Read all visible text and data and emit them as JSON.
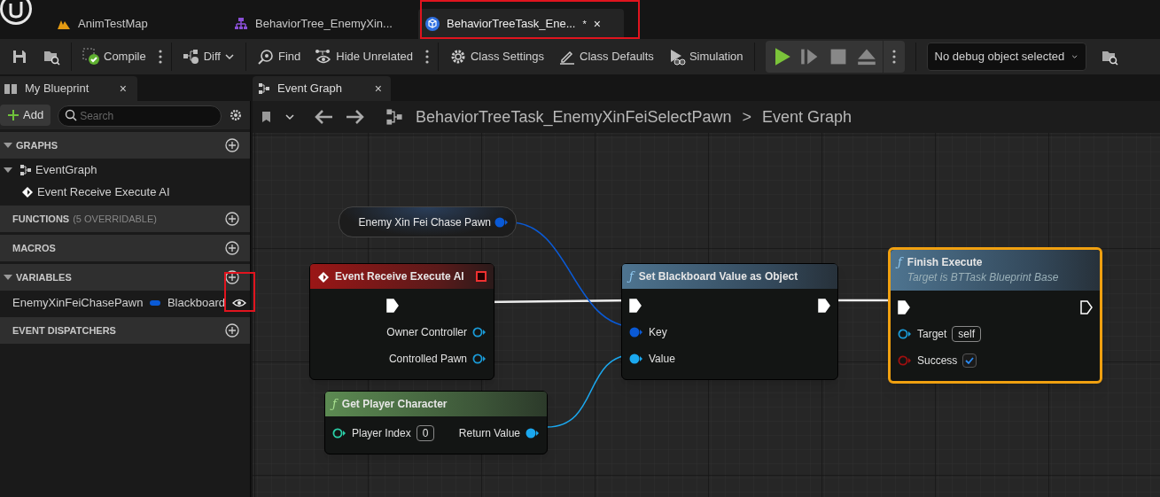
{
  "doc_tabs": [
    {
      "label": "AnimTestMap",
      "selected": false
    },
    {
      "label": "BehaviorTree_EnemyXin...",
      "selected": false
    },
    {
      "label": "BehaviorTreeTask_Ene...",
      "selected": true,
      "modified_mark": "*",
      "close": "×"
    }
  ],
  "toolbar": [
    {
      "kind": "icon"
    },
    {
      "kind": "icon"
    },
    {
      "kind": "sep"
    },
    {
      "kind": "button",
      "label": "Compile"
    },
    {
      "kind": "more"
    },
    {
      "kind": "sep"
    },
    {
      "kind": "button",
      "label": "Diff",
      "dropdown": true
    },
    {
      "kind": "sep"
    },
    {
      "kind": "button",
      "label": "Find"
    },
    {
      "kind": "button",
      "label": "Hide Unrelated"
    },
    {
      "kind": "more"
    },
    {
      "kind": "sep"
    },
    {
      "kind": "button",
      "label": "Class Settings"
    },
    {
      "kind": "button",
      "label": "Class Defaults"
    },
    {
      "kind": "button",
      "label": "Simulation"
    },
    {
      "kind": "sep"
    },
    {
      "kind": "play"
    },
    {
      "kind": "sep"
    },
    {
      "kind": "debug",
      "label": "No debug object selected"
    },
    {
      "kind": "icon"
    }
  ],
  "my_blueprint": {
    "title": "My Blueprint",
    "close": "×",
    "add": "Add",
    "search": {
      "placeholder": "Search"
    },
    "sections": [
      {
        "label": "GRAPHS",
        "expanded": true,
        "items": [
          {
            "label": "EventGraph",
            "expanded": true,
            "children": [
              {
                "label": "Event Receive Execute AI"
              }
            ]
          }
        ]
      },
      {
        "label": "FUNCTIONS",
        "note": "(5 OVERRIDABLE)",
        "expanded": false
      },
      {
        "label": "MACROS",
        "expanded": false
      },
      {
        "label": "VARIABLES",
        "expanded": true,
        "variables": [
          {
            "name": "EnemyXinFeiChasePawn",
            "type": "Blackboard",
            "color": "#0a5ad6"
          }
        ]
      },
      {
        "label": "EVENT DISPATCHERS",
        "expanded": false
      }
    ]
  },
  "graph_tab": {
    "label": "Event Graph",
    "close": "×"
  },
  "breadcrumb": [
    "BehaviorTreeTask_EnemyXinFeiSelectPawn",
    "Event Graph"
  ],
  "breadcrumb_sep": ">",
  "nodes": [
    {
      "kind": "variable",
      "title": "Enemy Xin Fei Chase Pawn",
      "selected": false,
      "right": [
        {
          "kind": "data",
          "color": "#0a5ad6",
          "connected": true
        }
      ]
    },
    {
      "kind": "event",
      "title": "Event Receive Execute AI",
      "selected": false,
      "right": [
        {
          "kind": "exec",
          "connected": true
        },
        {
          "kind": "data",
          "label": "Owner Controller",
          "color": "#1a9bd8",
          "connected": false
        },
        {
          "kind": "data",
          "label": "Controlled Pawn",
          "color": "#1a9bd8",
          "connected": false
        }
      ]
    },
    {
      "kind": "pure",
      "glyph": "ƒ",
      "title": "Get Player Character",
      "selected": false,
      "left": [
        {
          "kind": "data",
          "label": "Player Index",
          "color": "#2ad0a8",
          "connected": false,
          "value": "0"
        }
      ],
      "right": [
        {
          "kind": "data",
          "label": "Return Value",
          "color": "#1ba8ef",
          "connected": true
        }
      ]
    },
    {
      "kind": "function",
      "glyph": "ƒ",
      "title": "Set Blackboard Value as Object",
      "selected": false,
      "left": [
        {
          "kind": "exec",
          "connected": true
        },
        {
          "kind": "data",
          "label": "Key",
          "color": "#0a5ad6",
          "connected": true
        },
        {
          "kind": "data",
          "label": "Value",
          "color": "#1ba8ef",
          "connected": true
        }
      ],
      "right": [
        {
          "kind": "exec",
          "connected": true
        }
      ]
    },
    {
      "kind": "function",
      "glyph": "ƒ",
      "title": "Finish Execute",
      "subtitle": "Target is BTTask Blueprint Base",
      "selected": true,
      "left": [
        {
          "kind": "exec",
          "connected": true
        },
        {
          "kind": "data",
          "label": "Target",
          "color": "#1a9bd8",
          "connected": false,
          "value": "self"
        },
        {
          "kind": "bool",
          "label": "Success",
          "color": "#a00f0f",
          "connected": false,
          "checked": true
        }
      ],
      "right": [
        {
          "kind": "exec",
          "connected": false
        }
      ]
    }
  ]
}
